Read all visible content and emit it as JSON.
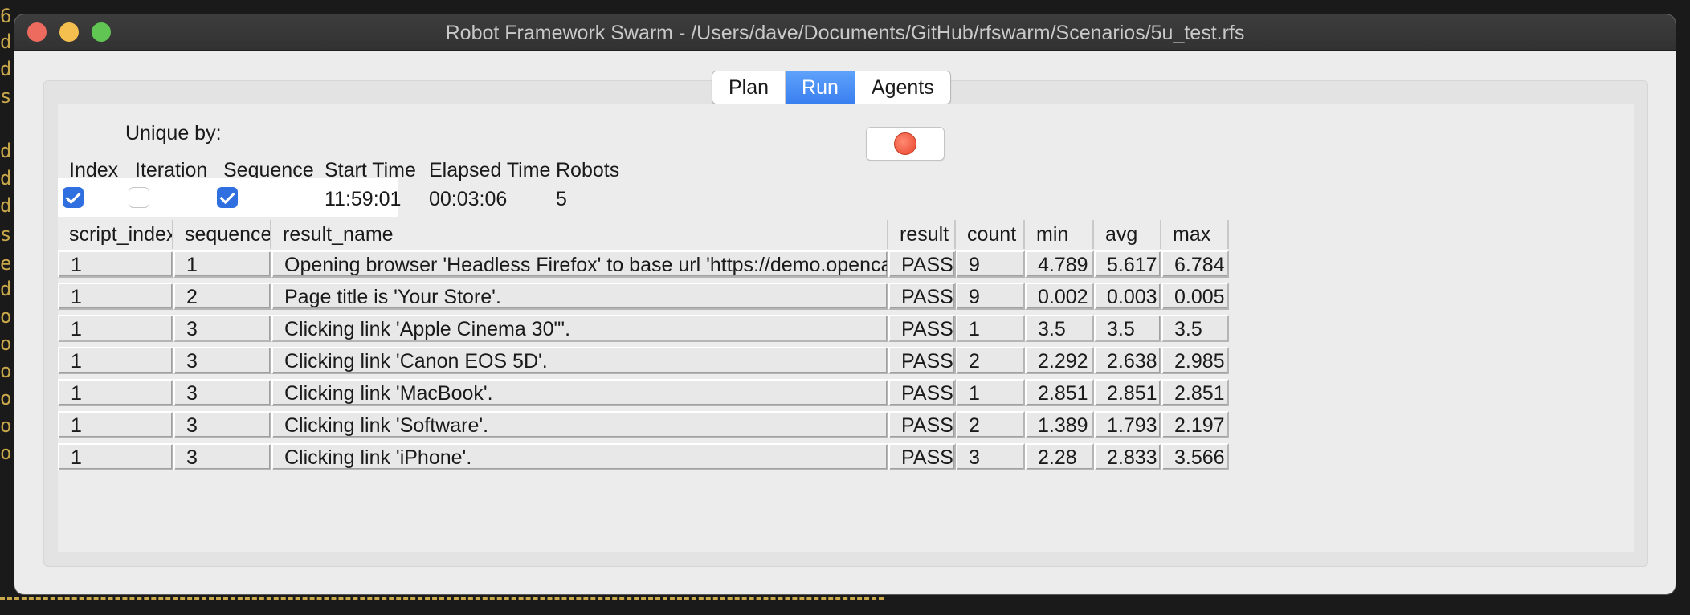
{
  "window": {
    "title": "Robot Framework Swarm - /Users/dave/Documents/GitHub/rfswarm/Scenarios/5u_test.rfs"
  },
  "tabs": [
    {
      "label": "Plan",
      "active": false
    },
    {
      "label": "Run",
      "active": true
    },
    {
      "label": "Agents",
      "active": false
    }
  ],
  "run": {
    "unique_by_label": "Unique by:",
    "headers": {
      "index": "Index",
      "iteration": "Iteration",
      "sequence": "Sequence",
      "start_time": "Start Time",
      "elapsed_time": "Elapsed Time",
      "robots": "Robots"
    },
    "checkbox_index": true,
    "checkbox_iteration": false,
    "checkbox_sequence": true,
    "start_time": "11:59:01",
    "elapsed_time": "00:03:06",
    "robots": "5",
    "stop_icon": "stop-icon",
    "stop_color": "#e9432a"
  },
  "table": {
    "columns": [
      "script_index",
      "sequence",
      "result_name",
      "result",
      "count",
      "min",
      "avg",
      "max"
    ],
    "rows": [
      [
        "1",
        "1",
        "Opening browser 'Headless Firefox' to base url 'https://demo.opencart.com/'.",
        "PASS",
        "9",
        "4.789",
        "5.617",
        "6.784"
      ],
      [
        "1",
        "2",
        "Page title is 'Your Store'.",
        "PASS",
        "9",
        "0.002",
        "0.003",
        "0.005"
      ],
      [
        "1",
        "3",
        "Clicking link 'Apple Cinema 30\"'.",
        "PASS",
        "1",
        "3.5",
        "3.5",
        "3.5"
      ],
      [
        "1",
        "3",
        "Clicking link 'Canon EOS 5D'.",
        "PASS",
        "2",
        "2.292",
        "2.638",
        "2.985"
      ],
      [
        "1",
        "3",
        "Clicking link 'MacBook'.",
        "PASS",
        "1",
        "2.851",
        "2.851",
        "2.851"
      ],
      [
        "1",
        "3",
        "Clicking link 'Software'.",
        "PASS",
        "2",
        "1.389",
        "1.793",
        "2.197"
      ],
      [
        "1",
        "3",
        "Clicking link 'iPhone'.",
        "PASS",
        "3",
        "2.28",
        "2.833",
        "3.566"
      ]
    ]
  },
  "colors": {
    "accent": "#3a7ff0",
    "close": "#ed6a5e",
    "minimize": "#f5bf4f",
    "maximize": "#61c554"
  }
}
